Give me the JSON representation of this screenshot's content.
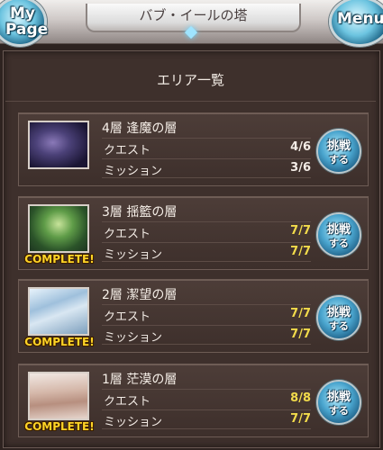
{
  "header": {
    "title": "バブ・イールの塔",
    "mypage_line1": "My",
    "mypage_line2": "Page",
    "menu_label": "Menu"
  },
  "panel": {
    "title": "エリア一覧"
  },
  "areas": [
    {
      "name": "4層 逢魔の層",
      "thumb": "dark-purple-sky",
      "complete": "",
      "quest_label": "クエスト",
      "quest_value": "4/6",
      "mission_label": "ミッション",
      "mission_value": "3/6",
      "button_line1": "挑戦",
      "button_line2": "する"
    },
    {
      "name": "3層 揺籃の層",
      "thumb": "green-forest",
      "complete": "COMPLETE!",
      "quest_label": "クエスト",
      "quest_value": "7/7",
      "mission_label": "ミッション",
      "mission_value": "7/7",
      "button_line1": "挑戦",
      "button_line2": "する"
    },
    {
      "name": "2層 潔望の層",
      "thumb": "icy-mountain",
      "complete": "COMPLETE!",
      "quest_label": "クエスト",
      "quest_value": "7/7",
      "mission_label": "ミッション",
      "mission_value": "7/7",
      "button_line1": "挑戦",
      "button_line2": "する"
    },
    {
      "name": "1層 茫漠の層",
      "thumb": "desert-dunes",
      "complete": "COMPLETE!",
      "quest_label": "クエスト",
      "quest_value": "8/8",
      "mission_label": "ミッション",
      "mission_value": "7/7",
      "button_line1": "挑戦",
      "button_line2": "する"
    }
  ],
  "colors": {
    "complete_text": "#ffd426",
    "done_value": "#f2db4b",
    "text": "#f3ece6"
  }
}
